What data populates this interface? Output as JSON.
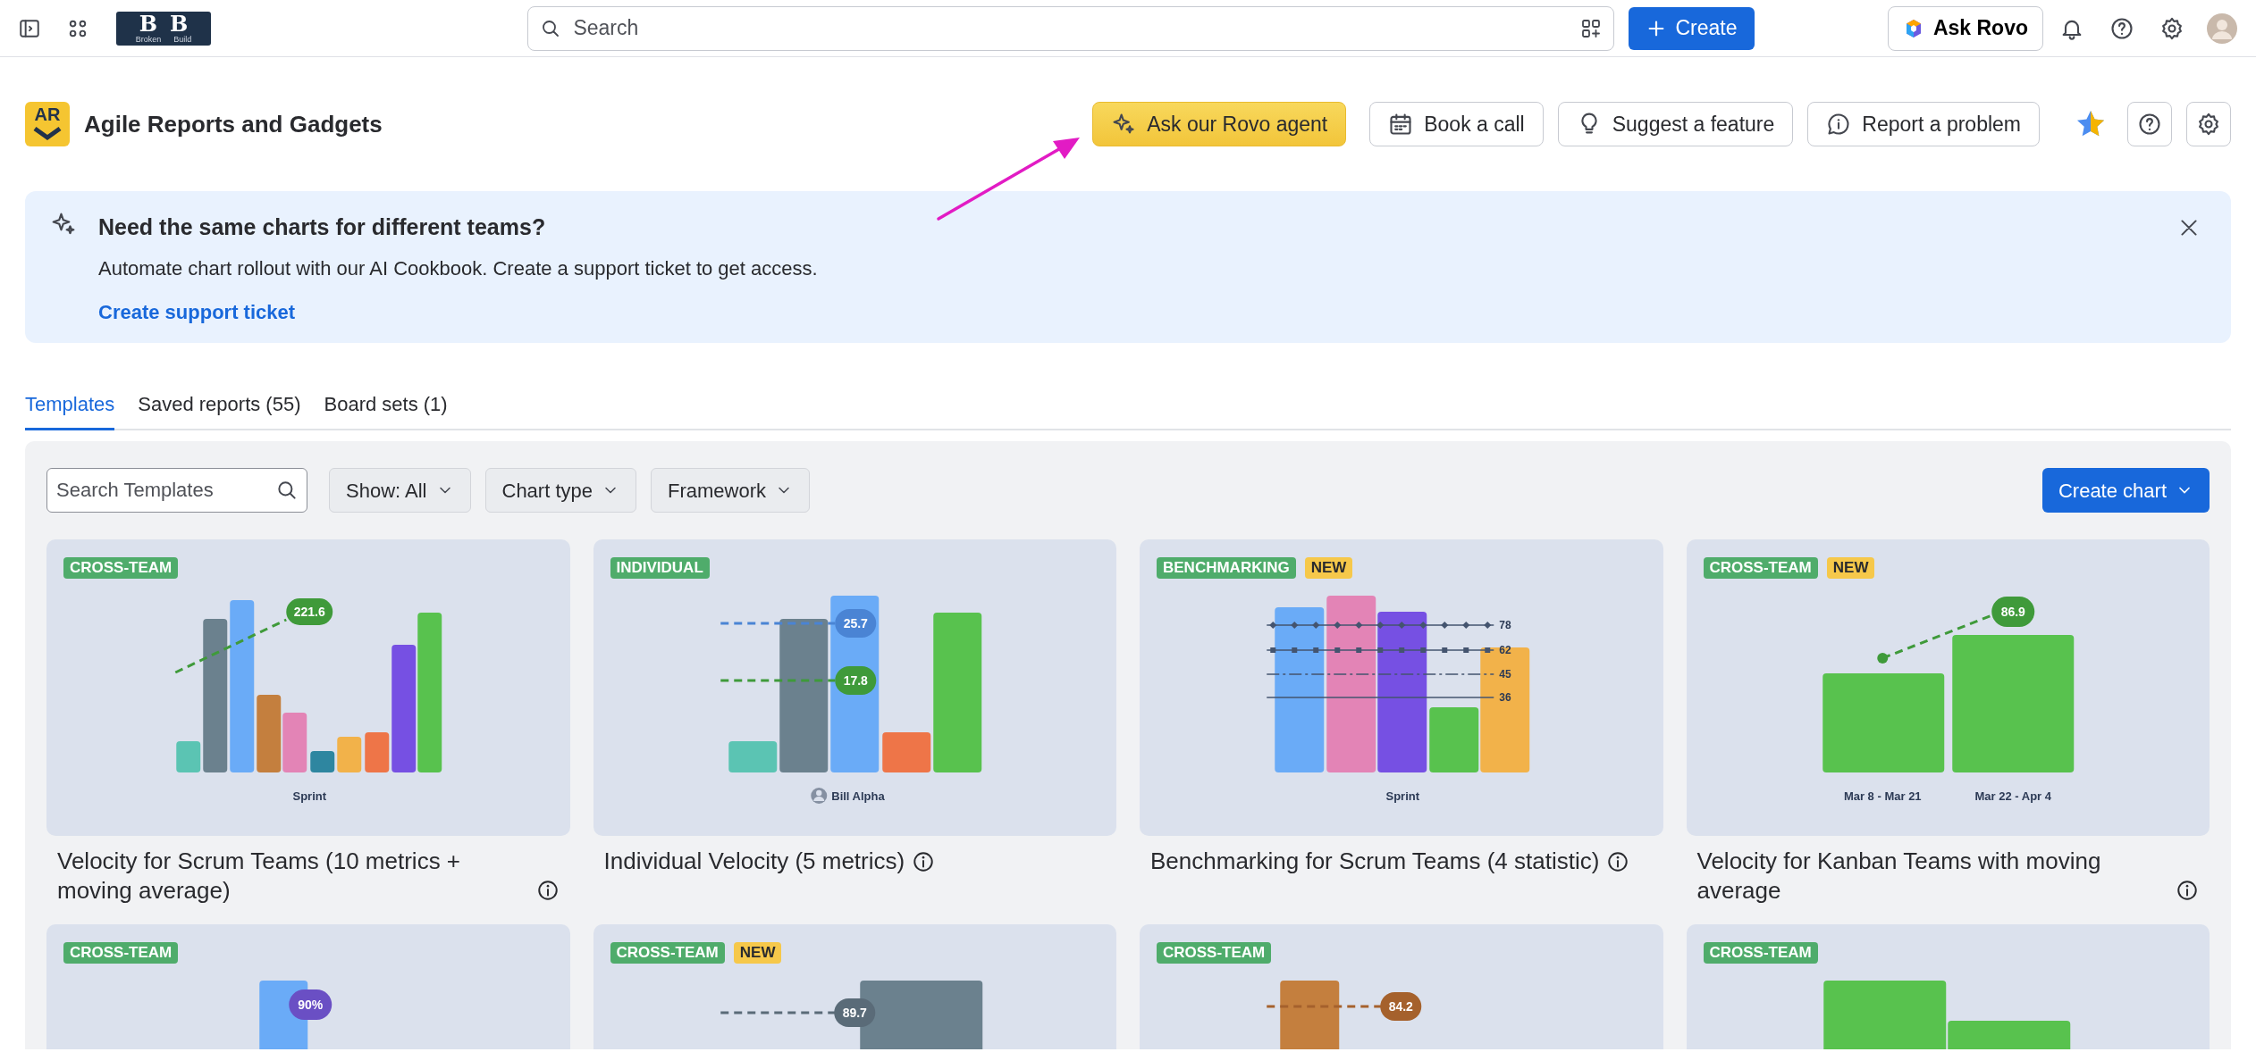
{
  "topbar": {
    "logo": {
      "letters": [
        "B",
        "B"
      ],
      "caption": [
        "Broken",
        "Build"
      ]
    },
    "search": {
      "placeholder": "Search"
    },
    "create": "Create",
    "ask_rovo": "Ask Rovo"
  },
  "app_header": {
    "logo_text": "AR",
    "title": "Agile Reports and Gadgets",
    "actions": [
      {
        "kind": "rovo",
        "label": "Ask our Rovo agent"
      },
      {
        "kind": "calendar",
        "label": "Book a call"
      },
      {
        "kind": "bulb",
        "label": "Suggest a feature"
      },
      {
        "kind": "report",
        "label": "Report a problem"
      }
    ]
  },
  "banner": {
    "title": "Need the same charts for different teams?",
    "text": "Automate chart rollout with our AI Cookbook. Create a support ticket to get access.",
    "link": "Create support ticket"
  },
  "tabs": [
    {
      "label": "Templates",
      "selected": true
    },
    {
      "label": "Saved reports (55)",
      "selected": false
    },
    {
      "label": "Board sets (1)",
      "selected": false
    }
  ],
  "toolbar": {
    "search": {
      "placeholder": "Search Templates"
    },
    "filters": [
      "Show: All",
      "Chart type",
      "Framework"
    ],
    "create_chart": "Create chart"
  },
  "templates": [
    {
      "badges": [
        {
          "text": "CROSS-TEAM",
          "kind": "category"
        }
      ],
      "preview": {
        "kind": "velocity",
        "values": [
          "221.6"
        ],
        "axis": [
          "Sprint"
        ]
      },
      "title": "Velocity for Scrum Teams (10 metrics + moving average)"
    },
    {
      "badges": [
        {
          "text": "INDIVIDUAL",
          "kind": "category"
        }
      ],
      "preview": {
        "kind": "individual",
        "values": [
          "25.7",
          "17.8"
        ],
        "axis": [
          "Bill Alpha"
        ]
      },
      "title": "Individual Velocity (5 metrics)"
    },
    {
      "badges": [
        {
          "text": "BENCHMARKING",
          "kind": "category"
        },
        {
          "text": "NEW",
          "kind": "new"
        }
      ],
      "preview": {
        "kind": "benchmark",
        "values": [
          "78",
          "62",
          "45",
          "36"
        ],
        "axis": [
          "Sprint"
        ]
      },
      "title": "Benchmarking for Scrum Teams (4 statistic)"
    },
    {
      "badges": [
        {
          "text": "CROSS-TEAM",
          "kind": "category"
        },
        {
          "text": "NEW",
          "kind": "new"
        }
      ],
      "preview": {
        "kind": "kanban",
        "values": [
          "86.9"
        ],
        "axis": [
          "Mar 8 - Mar 21",
          "Mar 22 - Apr 4"
        ]
      },
      "title": "Velocity for Kanban Teams with moving average"
    },
    {
      "badges": [
        {
          "text": "CROSS-TEAM",
          "kind": "category"
        }
      ],
      "preview": {
        "kind": "percent",
        "values": [
          "90%"
        ]
      }
    },
    {
      "badges": [
        {
          "text": "CROSS-TEAM",
          "kind": "category"
        },
        {
          "text": "NEW",
          "kind": "new"
        }
      ],
      "preview": {
        "kind": "grey-line",
        "values": [
          "89.7"
        ]
      }
    },
    {
      "badges": [
        {
          "text": "CROSS-TEAM",
          "kind": "category"
        }
      ],
      "preview": {
        "kind": "brown-line",
        "values": [
          "84.2"
        ]
      }
    },
    {
      "badges": [
        {
          "text": "CROSS-TEAM",
          "kind": "category"
        }
      ],
      "preview": {
        "kind": "green-bars"
      }
    }
  ]
}
